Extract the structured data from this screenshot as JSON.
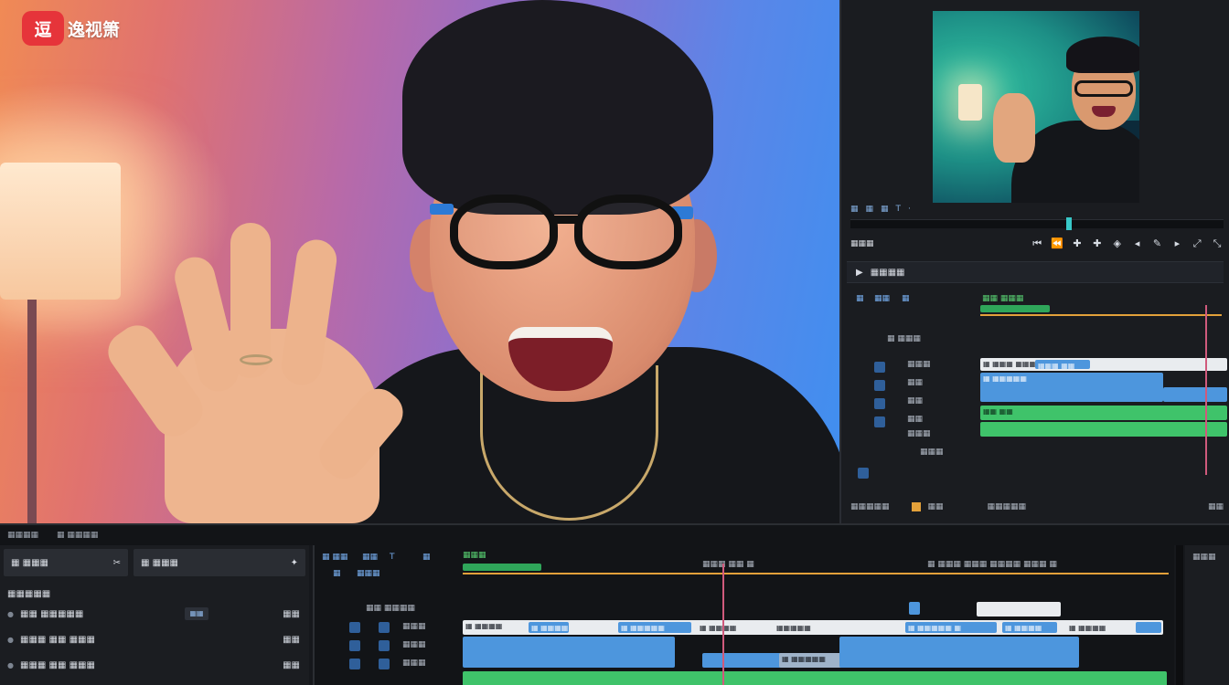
{
  "logo": {
    "badge": "逗",
    "text": "逸视箫"
  },
  "colors": {
    "accent_blue": "#4d96dd",
    "accent_green": "#3fc36a",
    "playhead": "#d05a7c",
    "logo_red": "#e6343a"
  },
  "right_panel": {
    "monitor_controls": [
      "▦",
      "▦",
      "▦",
      "T",
      "·"
    ],
    "tool_row_label": "▦▦▦",
    "tools": [
      "⏮",
      "⏪",
      "✚",
      "✚",
      "◈",
      "◂",
      "✎",
      "▸",
      "⤢",
      "⤡"
    ],
    "sequence_header": "▦▦▦▦",
    "track_header": [
      "▦",
      "▦▦",
      "▦"
    ],
    "ruler_label": "▦▦ ▦▦▦",
    "track_labels": [
      "▦ ▦▦▦",
      "▦▦▦",
      "▦▦",
      "▦▦",
      "▦▦",
      "▦▦▦",
      "▦▦▦"
    ],
    "clips": [
      "▦ ▦▦▦ ▦▦▦",
      "▦▦▦ ▦▦",
      "▦ ▦▦▦▦▦",
      "▦▦ ▦▦"
    ],
    "footer": [
      "▦▦▦▦▦",
      "▦▦",
      "▦▦▦▦▦",
      "▦▦"
    ]
  },
  "bottom": {
    "header_items": [
      "▦▦▦▦",
      "▦ ▦▦▦▦"
    ],
    "tabs": [
      {
        "label": "▦ ▦▦▦",
        "icon": "✂"
      },
      {
        "label": "▦ ▦▦▦",
        "icon": "✦"
      }
    ],
    "section_title": "▦▦▦▦▦",
    "properties": [
      {
        "name": "▦▦ ▦▦▦▦▦",
        "value": "▦▦"
      },
      {
        "name": "▦▦▦ ▦▦ ▦▦▦",
        "value": "▦▦"
      },
      {
        "name": "▦▦▦ ▦▦ ▦▦▦",
        "value": "▦▦"
      }
    ],
    "timeline_header": [
      "▦ ▦▦",
      "▦▦",
      "T",
      "▦"
    ],
    "timeline_sub": [
      "▦",
      "▦▦▦"
    ],
    "ruler_marks": [
      "▦▦▦ ▦▦ ▦",
      "▦ ▦▦▦ ▦▦▦ ▦▦▦▦ ▦▦▦ ▦"
    ],
    "track_labels": [
      "▦▦ ▦▦▦▦",
      "▦▦▦",
      "▦▦▦",
      "▦▦▦"
    ],
    "clips": [
      "▦ ▦▦▦▦",
      "▦ ▦▦▦▦▦",
      "▦ ▦▦▦▦▦",
      "▦ ▦▦▦▦",
      "▦▦▦▦▦",
      "▦ ▦▦▦▦▦ ▦",
      "▦ ▦▦▦▦",
      "▦ ▦▦▦▦",
      "▦ ▦▦▦▦▦"
    ],
    "far_right_label": "▦▦▦"
  }
}
